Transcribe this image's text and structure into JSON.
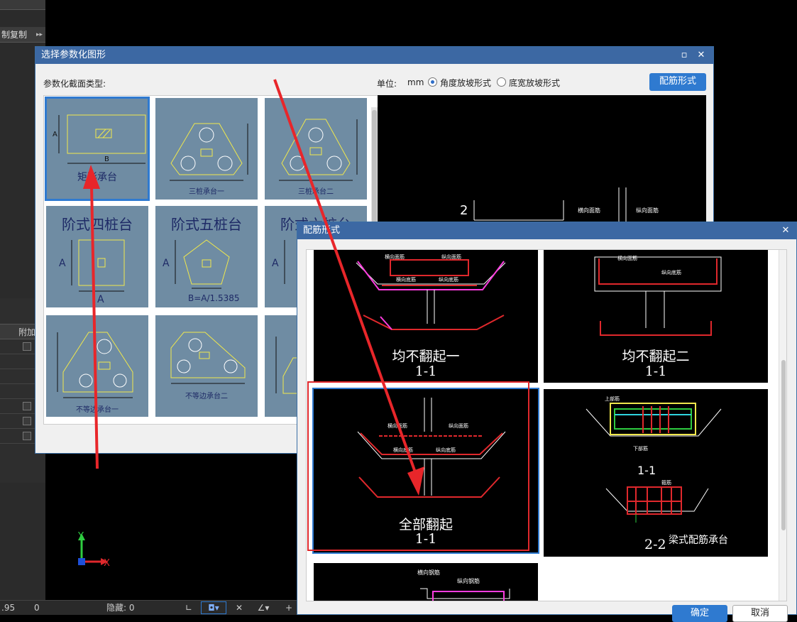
{
  "background": {
    "copy_label": "制复制",
    "grid_header": "附加",
    "status_value1": ".95",
    "status_value2": "0",
    "status_hidden_label": "隐藏: 0",
    "axis_y": "Y",
    "axis_x": "X"
  },
  "dialog1": {
    "title": "选择参数化图形",
    "section_type_label": "参数化截面类型:",
    "unit_label": "单位:",
    "unit_value": "mm",
    "radio_options": [
      {
        "label": "角度放坡形式",
        "checked": true
      },
      {
        "label": "底宽放坡形式",
        "checked": false
      }
    ],
    "rebar_button": "配筋形式",
    "thumbnails": [
      {
        "caption": "矩形承台",
        "selected": true
      },
      {
        "caption": "三桩承台一"
      },
      {
        "caption": "三桩承台二"
      },
      {
        "caption": "阶式四桩台"
      },
      {
        "caption": "阶式五桩台"
      },
      {
        "caption": "阶式六桩台"
      },
      {
        "caption": "不等边承台一"
      },
      {
        "caption": "不等边承台二"
      },
      {
        "caption": ""
      }
    ],
    "dims": {
      "a": "A",
      "b": "B",
      "formula": "B=A/1.5385"
    },
    "preview": {
      "label_2": "2",
      "rebar1": "横向面筋",
      "rebar2": "纵向面筋"
    }
  },
  "dialog2": {
    "title": "配筋形式",
    "options": [
      {
        "title": "均不翻起一",
        "section": "1-1"
      },
      {
        "title": "均不翻起二",
        "section": "1-1"
      },
      {
        "title": "全部翻起",
        "section": "1-1",
        "selected": true
      },
      {
        "title": "梁式配筋承台",
        "section": "2-2",
        "section2": "1-1"
      },
      {
        "title": "",
        "section": ""
      }
    ],
    "rebar_labels": {
      "h_top": "横向面筋",
      "v_top": "纵向面筋",
      "h_bot": "横向底筋",
      "v_bot": "纵向底筋",
      "top_bar": "上部筋",
      "bot_bar": "下部筋",
      "stir": "箍筋",
      "h_steel": "横向钢筋",
      "v_steel": "纵向钢筋"
    },
    "ok_button": "确定",
    "cancel_button": "取消"
  },
  "colors": {
    "accent": "#2f7ad0",
    "titlebar": "#3c68a3",
    "thumb_bg": "#6f8ca3",
    "annotation": "#e0282c"
  }
}
